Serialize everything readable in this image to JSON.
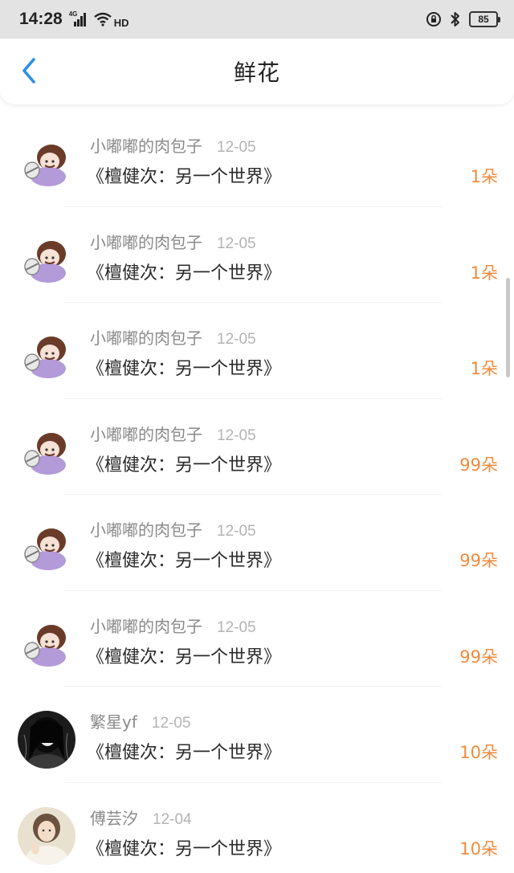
{
  "status_bar": {
    "time": "14:28",
    "network": "4G",
    "hd": "HD",
    "battery": "85"
  },
  "header": {
    "title": "鲜花"
  },
  "colors": {
    "accent_blue": "#2a8fe6",
    "count_orange": "#f08a3c"
  },
  "items": [
    {
      "name": "小嘟嘟的肉包子",
      "date": "12-05",
      "book": "《檀健次：另一个世界》",
      "count": "1朵",
      "avatar": "cartoon-avatar"
    },
    {
      "name": "小嘟嘟的肉包子",
      "date": "12-05",
      "book": "《檀健次：另一个世界》",
      "count": "1朵",
      "avatar": "cartoon-avatar"
    },
    {
      "name": "小嘟嘟的肉包子",
      "date": "12-05",
      "book": "《檀健次：另一个世界》",
      "count": "1朵",
      "avatar": "cartoon-avatar"
    },
    {
      "name": "小嘟嘟的肉包子",
      "date": "12-05",
      "book": "《檀健次：另一个世界》",
      "count": "99朵",
      "avatar": "cartoon-avatar"
    },
    {
      "name": "小嘟嘟的肉包子",
      "date": "12-05",
      "book": "《檀健次：另一个世界》",
      "count": "99朵",
      "avatar": "cartoon-avatar"
    },
    {
      "name": "小嘟嘟的肉包子",
      "date": "12-05",
      "book": "《檀健次：另一个世界》",
      "count": "99朵",
      "avatar": "cartoon-avatar"
    },
    {
      "name": "繁星yf",
      "date": "12-05",
      "book": "《檀健次：另一个世界》",
      "count": "10朵",
      "avatar": "dark-portrait-avatar"
    },
    {
      "name": "傅芸汐",
      "date": "12-04",
      "book": "《檀健次：另一个世界》",
      "count": "10朵",
      "avatar": "photo-portrait-avatar"
    }
  ]
}
